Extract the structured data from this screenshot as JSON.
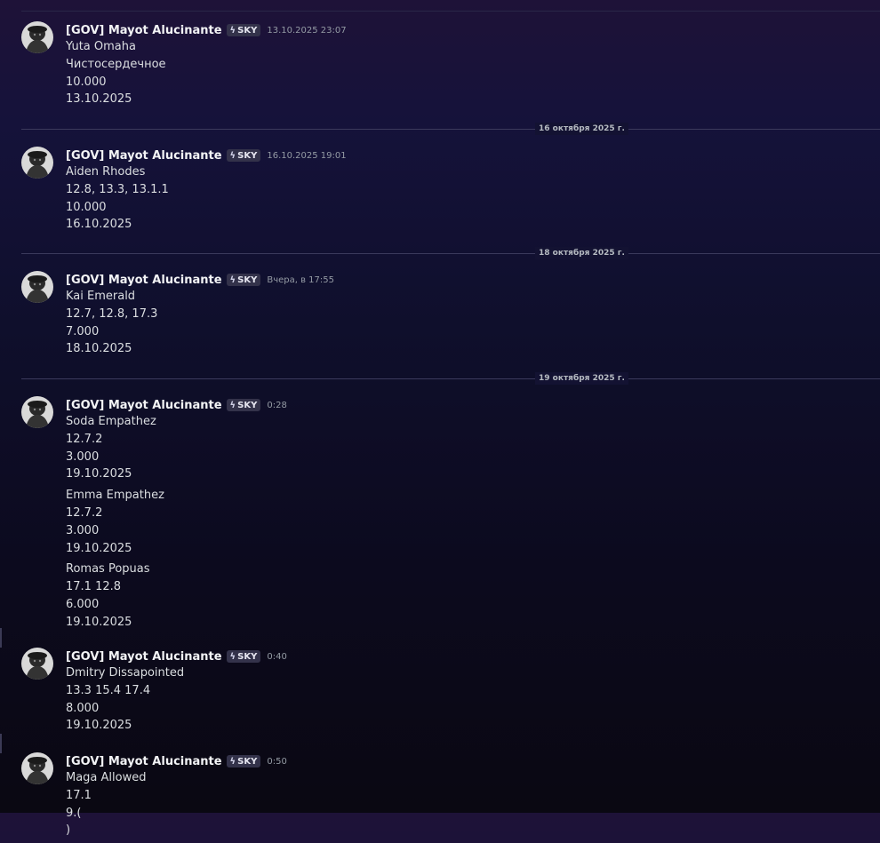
{
  "messages": [
    {
      "author": "[GOV] Mayot Alucinante",
      "tag": "SKY",
      "time": "13.10.2025 23:07",
      "groups": [
        [
          "Yuta Omaha",
          "Чистосердечное",
          "10.000",
          "13.10.2025"
        ]
      ]
    },
    {
      "author": "[GOV] Mayot Alucinante",
      "tag": "SKY",
      "time": "16.10.2025 19:01",
      "groups": [
        [
          "Aiden Rhodes",
          "12.8, 13.3, 13.1.1",
          "10.000",
          "16.10.2025"
        ]
      ]
    },
    {
      "author": "[GOV] Mayot Alucinante",
      "tag": "SKY",
      "time": "Вчера, в 17:55",
      "groups": [
        [
          "Kai Emerald",
          "12.7, 12.8, 17.3",
          "7.000",
          "18.10.2025"
        ]
      ]
    },
    {
      "author": "[GOV] Mayot Alucinante",
      "tag": "SKY",
      "time": "0:28",
      "groups": [
        [
          "Soda Empathez",
          "12.7.2",
          "3.000",
          "19.10.2025"
        ],
        [
          "Emma Empathez",
          "12.7.2",
          "3.000",
          "19.10.2025"
        ],
        [
          "Romas Popuas",
          "17.1 12.8",
          "6.000",
          "19.10.2025"
        ]
      ]
    },
    {
      "author": "[GOV] Mayot Alucinante",
      "tag": "SKY",
      "time": "0:40",
      "groups": [
        [
          "Dmitry Dissapointed",
          "13.3 15.4 17.4",
          "8.000",
          "19.10.2025"
        ]
      ]
    },
    {
      "author": "[GOV] Mayot Alucinante",
      "tag": "SKY",
      "time": "0:50",
      "groups": [
        [
          "Maga Allowed",
          "17.1",
          "9.(",
          ")"
        ]
      ]
    }
  ],
  "dividers": [
    "16 октября 2025 г.",
    "18 октября 2025 г.",
    "19 октября 2025 г."
  ],
  "icons": {
    "tag": "bolt-icon",
    "avatar": "user-avatar"
  }
}
